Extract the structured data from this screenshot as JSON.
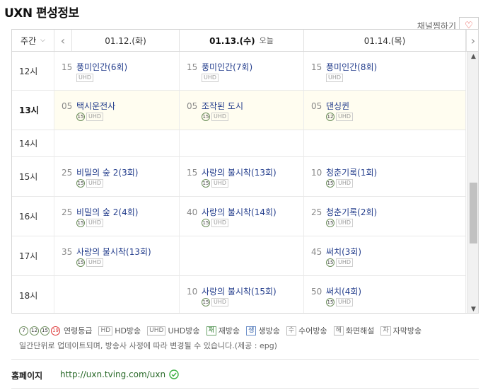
{
  "page": {
    "title": "UXN 편성정보",
    "favorite_label": "채널찜하기",
    "favorite_icon": "heart-icon"
  },
  "header": {
    "week_select": "주간",
    "days": [
      {
        "date": "01.12.(화)",
        "today": false,
        "today_label": ""
      },
      {
        "date": "01.13.(수)",
        "today": true,
        "today_label": "오늘"
      },
      {
        "date": "01.14.(목)",
        "today": false,
        "today_label": ""
      }
    ]
  },
  "schedule": [
    {
      "hour": "12시",
      "now": false,
      "cells": [
        {
          "min": "15",
          "name": "풍미인간(6회)",
          "rating": "",
          "tag": "UHD"
        },
        {
          "min": "15",
          "name": "풍미인간(7회)",
          "rating": "",
          "tag": "UHD"
        },
        {
          "min": "15",
          "name": "풍미인간(8회)",
          "rating": "",
          "tag": "UHD"
        }
      ]
    },
    {
      "hour": "13시",
      "now": true,
      "cells": [
        {
          "min": "05",
          "name": "택시운전사",
          "rating": "15",
          "tag": "UHD"
        },
        {
          "min": "05",
          "name": "조작된 도시",
          "rating": "15",
          "tag": "UHD"
        },
        {
          "min": "05",
          "name": "댄싱퀸",
          "rating": "12",
          "tag": "UHD"
        }
      ]
    },
    {
      "hour": "14시",
      "now": false,
      "cells": [
        null,
        null,
        null
      ]
    },
    {
      "hour": "15시",
      "now": false,
      "cells": [
        {
          "min": "25",
          "name": "비밀의 숲 2(3회)",
          "rating": "15",
          "tag": "UHD"
        },
        {
          "min": "15",
          "name": "사랑의 불시착(13회)",
          "rating": "15",
          "tag": "UHD"
        },
        {
          "min": "10",
          "name": "청춘기록(1회)",
          "rating": "15",
          "tag": "UHD"
        }
      ]
    },
    {
      "hour": "16시",
      "now": false,
      "cells": [
        {
          "min": "25",
          "name": "비밀의 숲 2(4회)",
          "rating": "15",
          "tag": "UHD"
        },
        {
          "min": "40",
          "name": "사랑의 불시착(14회)",
          "rating": "15",
          "tag": "UHD"
        },
        {
          "min": "25",
          "name": "청춘기록(2회)",
          "rating": "15",
          "tag": "UHD"
        }
      ]
    },
    {
      "hour": "17시",
      "now": false,
      "cells": [
        {
          "min": "35",
          "name": "사랑의 불시착(13회)",
          "rating": "15",
          "tag": "UHD"
        },
        null,
        {
          "min": "45",
          "name": "써치(3회)",
          "rating": "15",
          "tag": "UHD"
        }
      ]
    },
    {
      "hour": "18시",
      "now": false,
      "cells": [
        null,
        {
          "min": "10",
          "name": "사랑의 불시착(15회)",
          "rating": "15",
          "tag": "UHD"
        },
        {
          "min": "50",
          "name": "써치(4회)",
          "rating": "15",
          "tag": "UHD"
        }
      ]
    }
  ],
  "legend": {
    "ratings": [
      "7",
      "12",
      "15",
      "19"
    ],
    "rating_label": "연령등급",
    "items": [
      {
        "mark": "HD",
        "label": "HD방송",
        "style": ""
      },
      {
        "mark": "UHD",
        "label": "UHD방송",
        "style": ""
      },
      {
        "mark": "재",
        "label": "재방송",
        "style": "g"
      },
      {
        "mark": "생",
        "label": "생방송",
        "style": "b"
      },
      {
        "mark": "수",
        "label": "수어방송",
        "style": ""
      },
      {
        "mark": "해",
        "label": "화면해설",
        "style": ""
      },
      {
        "mark": "자",
        "label": "자막방송",
        "style": ""
      }
    ],
    "note": "일간단위로 업데이트되며, 방송사 사정에 따라 변경될 수 있습니다.(제공 : epg)"
  },
  "homepage": {
    "label": "홈페이지",
    "url": "http://uxn.tving.com/uxn",
    "verified_icon": "check-circle-icon"
  },
  "colors": {
    "link": "#233d8c",
    "now_row_bg": "#fffdf0",
    "heart": "#e4322b",
    "check": "#3cb043"
  }
}
